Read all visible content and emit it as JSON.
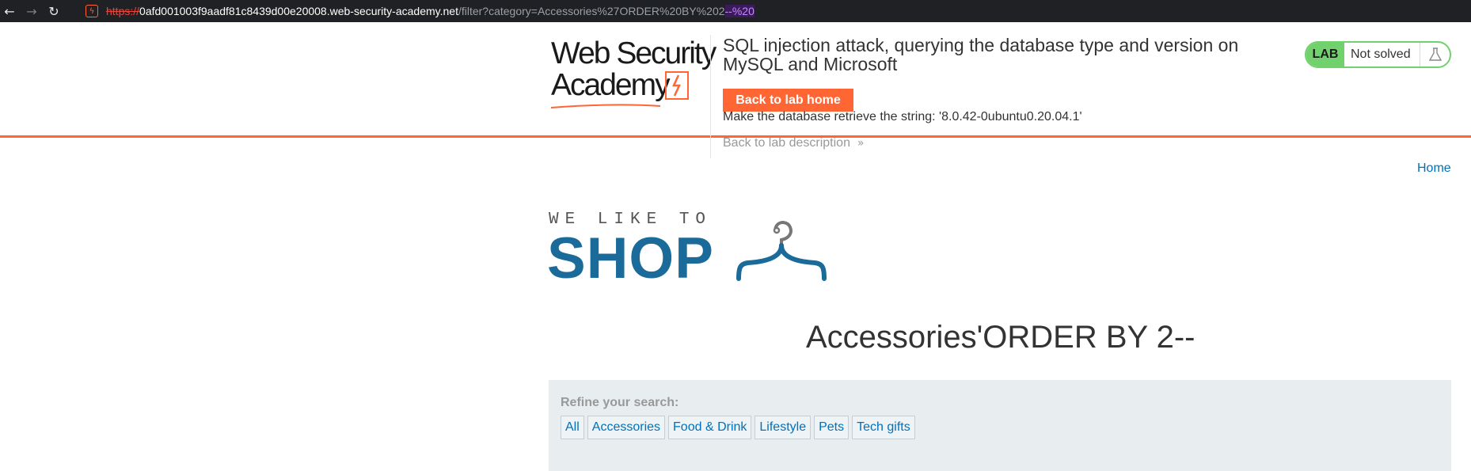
{
  "browser": {
    "url_scheme": "https://",
    "url_host": "0afd001003f9aadf81c8439d00e20008.web-security-academy.net",
    "url_path": "/filter?category=Accessories%27ORDER%20BY%202",
    "url_highlight": "--%20"
  },
  "academy": {
    "logo_line1": "Web Security",
    "logo_line2": "Academy",
    "lab_title": "SQL injection attack, querying the database type and version on MySQL and Microsoft",
    "back_home_label": "Back to lab home",
    "instruction": "Make the database retrieve the string: '8.0.42-0ubuntu0.20.04.1'",
    "back_description_label": "Back to lab description",
    "lab_badge": "LAB",
    "status": "Not solved",
    "accent_color": "#ff6633",
    "status_color": "#70d16d"
  },
  "nav": {
    "home_label": "Home"
  },
  "shop_logo": {
    "tagline": "WE LIKE TO",
    "word": "SHOP"
  },
  "main": {
    "heading": "Accessories'ORDER BY 2--",
    "refine_label": "Refine your search:",
    "filters": [
      "All",
      "Accessories",
      "Food & Drink",
      "Lifestyle",
      "Pets",
      "Tech gifts"
    ]
  }
}
